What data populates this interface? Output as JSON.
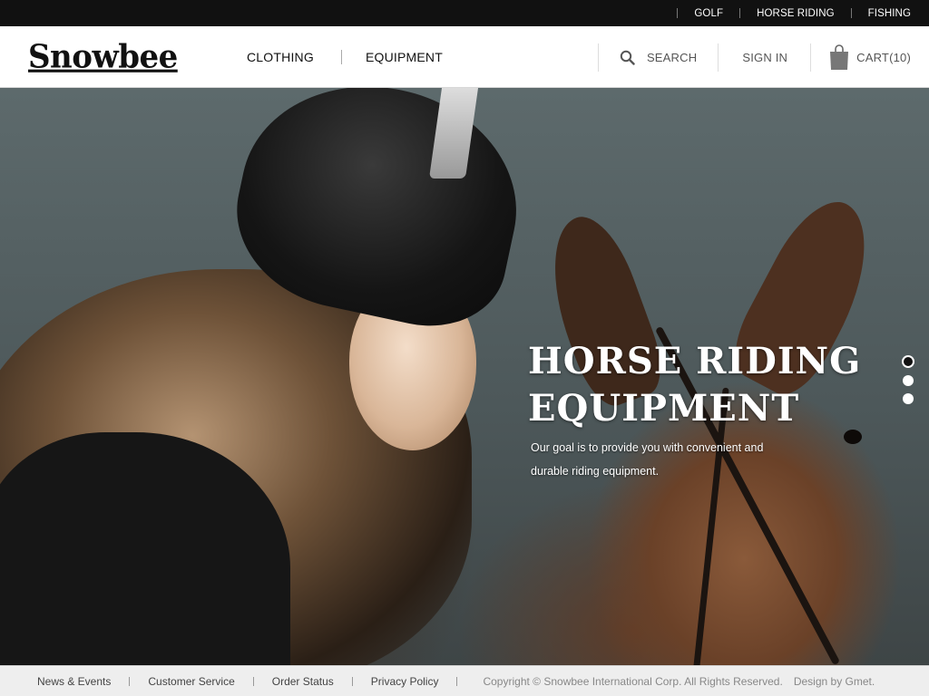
{
  "topbar": {
    "links": [
      "GOLF",
      "HORSE RIDING",
      "FISHING"
    ]
  },
  "header": {
    "logo": "Snowbee",
    "nav": [
      "CLOTHING",
      "EQUIPMENT"
    ],
    "search_label": "SEARCH",
    "signin_label": "SIGN IN",
    "cart_label": "CART(10)",
    "icons": {
      "search": "search-icon",
      "cart": "shopping-bag-icon"
    }
  },
  "hero": {
    "title_line1": "HORSE RIDING",
    "title_line2": "EQUIPMENT",
    "desc_line1": "Our goal is to provide you with convenient and",
    "desc_line2": "durable riding equipment.",
    "slides": {
      "count": 3,
      "active": 1
    }
  },
  "footer": {
    "links": [
      "News & Events",
      "Customer Service",
      "Order Status",
      "Privacy Policy"
    ],
    "copyright": "Copyright ©  Snowbee International Corp.  All Rights Reserved.",
    "credit": "Design by Gmet."
  },
  "colors": {
    "topbar_bg": "#111111",
    "footer_bg": "#eeeeee",
    "text_dark": "#111111"
  }
}
